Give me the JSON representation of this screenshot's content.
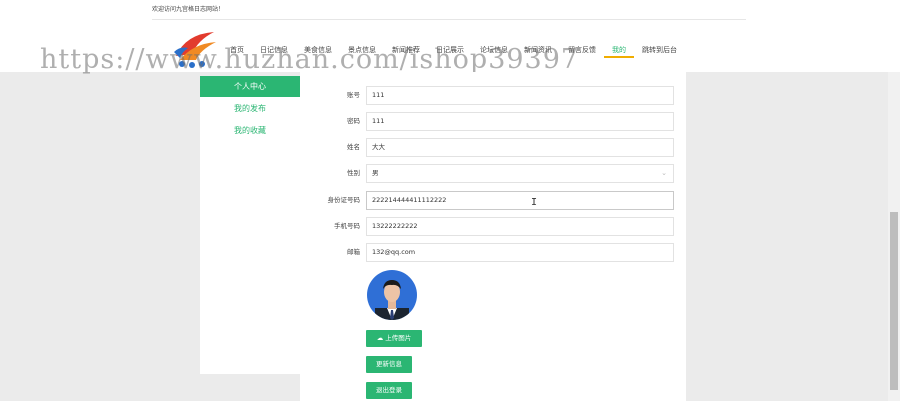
{
  "header": {
    "welcome": "欢迎访问九宫格日志网站！",
    "nav": [
      "首页",
      "日记信息",
      "美食信息",
      "景点信息",
      "新闻推荐",
      "日记展示",
      "论坛信息",
      "新闻资讯",
      "留言反馈",
      "我的",
      "跳转到后台"
    ],
    "active_nav": "我的"
  },
  "watermark": "https://www.huzhan.com/ishop39397",
  "sidebar": {
    "items": [
      "个人中心",
      "我的发布",
      "我的收藏"
    ]
  },
  "form": {
    "fields": [
      {
        "label": "账号",
        "value": "111"
      },
      {
        "label": "密码",
        "value": "111"
      },
      {
        "label": "姓名",
        "value": "大大"
      },
      {
        "label": "性别",
        "value": "男"
      },
      {
        "label": "身份证号码",
        "value": "222214444411112222"
      },
      {
        "label": "手机号码",
        "value": "13222222222"
      },
      {
        "label": "邮箱",
        "value": "132@qq.com"
      }
    ],
    "upload_label": "上传图片",
    "update_label": "更新信息",
    "logout_label": "退出登录"
  },
  "colors": {
    "accent": "#2bb673",
    "nav_underline": "#f0ad00"
  }
}
